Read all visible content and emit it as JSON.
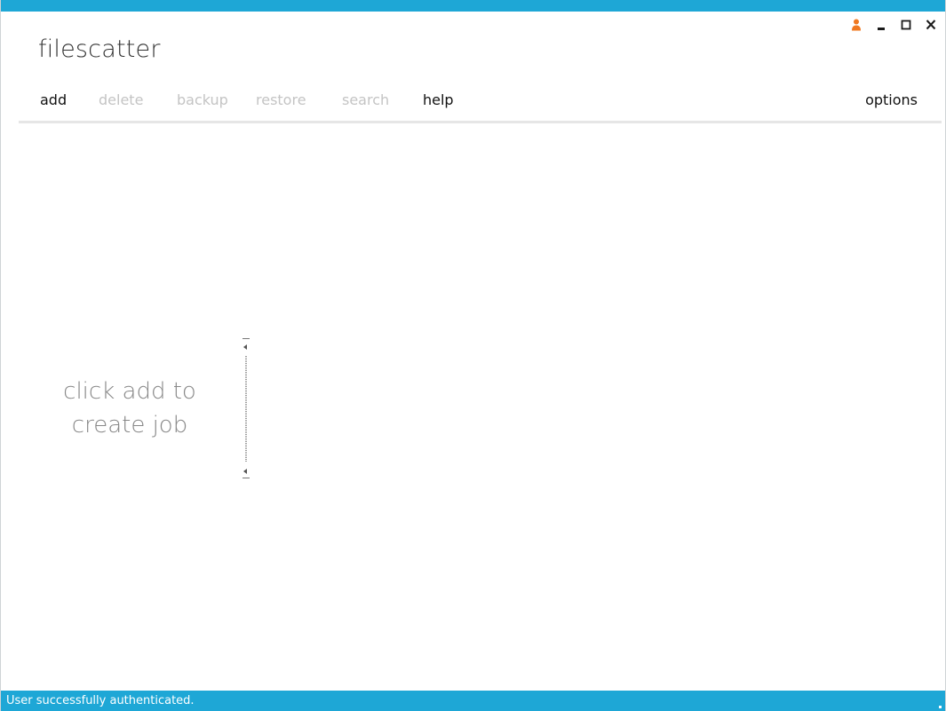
{
  "app": {
    "title": "filescatter"
  },
  "window_controls": {
    "user_icon": "user-icon",
    "minimize_icon": "minimize-icon",
    "maximize_icon": "maximize-icon",
    "close_icon": "close-icon"
  },
  "menu": {
    "add": "add",
    "delete": "delete",
    "backup": "backup",
    "restore": "restore",
    "search": "search",
    "help": "help",
    "options": "options"
  },
  "main": {
    "empty_line1": "click add to",
    "empty_line2": "create job"
  },
  "status": {
    "text": "User successfully authenticated."
  },
  "colors": {
    "accent": "#1ea7d6",
    "user_icon": "#f07820",
    "disabled_text": "#c4c4c4"
  }
}
